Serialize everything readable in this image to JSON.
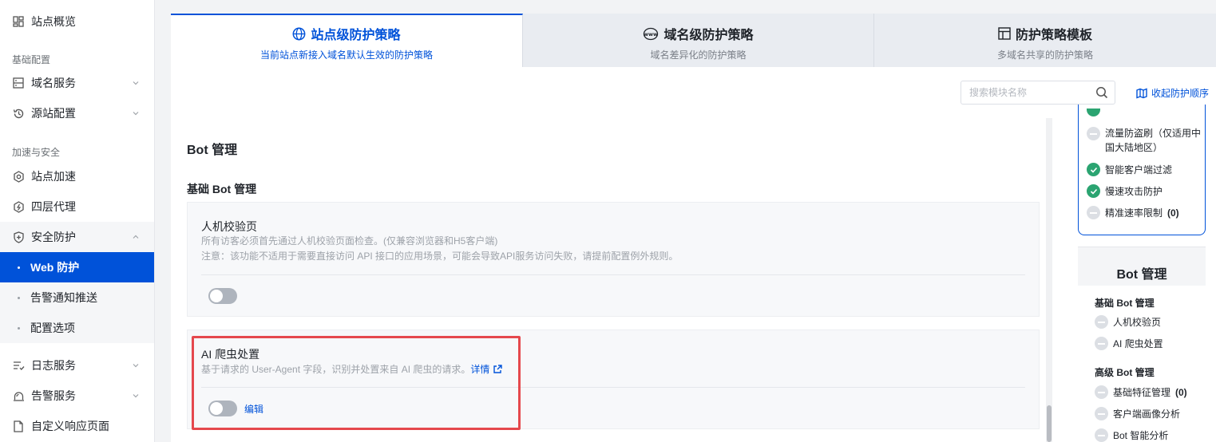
{
  "sidebar": {
    "overview": "站点概览",
    "group_basic": "基础配置",
    "domain_service": "域名服务",
    "origin_config": "源站配置",
    "group_accel_security": "加速与安全",
    "site_accel": "站点加速",
    "l4_proxy": "四层代理",
    "security": "安全防护",
    "web_protection": "Web 防护",
    "alert_push": "告警通知推送",
    "config_options": "配置选项",
    "log_service": "日志服务",
    "alert_service": "告警服务",
    "custom_page": "自定义响应页面"
  },
  "tabs": [
    {
      "title": "站点级防护策略",
      "subtitle": "当前站点新接入域名默认生效的防护策略",
      "icon": "globe-icon"
    },
    {
      "title": "域名级防护策略",
      "subtitle": "域名差异化的防护策略",
      "icon": "www-icon"
    },
    {
      "title": "防护策略模板",
      "subtitle": "多域名共享的防护策略",
      "icon": "template-icon"
    }
  ],
  "search": {
    "placeholder": "搜索模块名称"
  },
  "collapse_label": "收起防护顺序",
  "content": {
    "section_title": "Bot 管理",
    "basic_title": "基础 Bot 管理",
    "card1": {
      "title": "人机校验页",
      "desc1": "所有访客必须首先通过人机校验页面检查。(仅兼容浏览器和H5客户端)",
      "desc2": "注意：该功能不适用于需要直接访问 API 接口的应用场景，可能会导致API服务访问失败，请提前配置例外规则。"
    },
    "card2": {
      "title": "AI 爬虫处置",
      "desc": "基于请求的 User-Agent 字段，识别并处置来自 AI 爬虫的请求。",
      "detail": "详情",
      "edit": "编辑"
    }
  },
  "right_panel": {
    "items": [
      {
        "label": "流量防盗刷（仅适用中国大陆地区）",
        "status": "off"
      },
      {
        "label": "智能客户端过滤",
        "status": "on"
      },
      {
        "label": "慢速攻击防护",
        "status": "on"
      },
      {
        "label": "精准速率限制",
        "count": "(0)",
        "status": "off"
      }
    ],
    "bot_title": "Bot 管理",
    "basic_group": "基础 Bot 管理",
    "basic_items": [
      "人机校验页",
      "AI 爬虫处置"
    ],
    "advanced_group": "高级 Bot 管理",
    "advanced_items": [
      {
        "label": "基础特征管理",
        "count": "(0)"
      },
      {
        "label": "客户端画像分析",
        "count": ""
      },
      {
        "label": "Bot 智能分析",
        "count": ""
      }
    ]
  },
  "colors": {
    "accent": "#0052d9",
    "success": "#2ba471",
    "highlight": "#e5484d"
  }
}
